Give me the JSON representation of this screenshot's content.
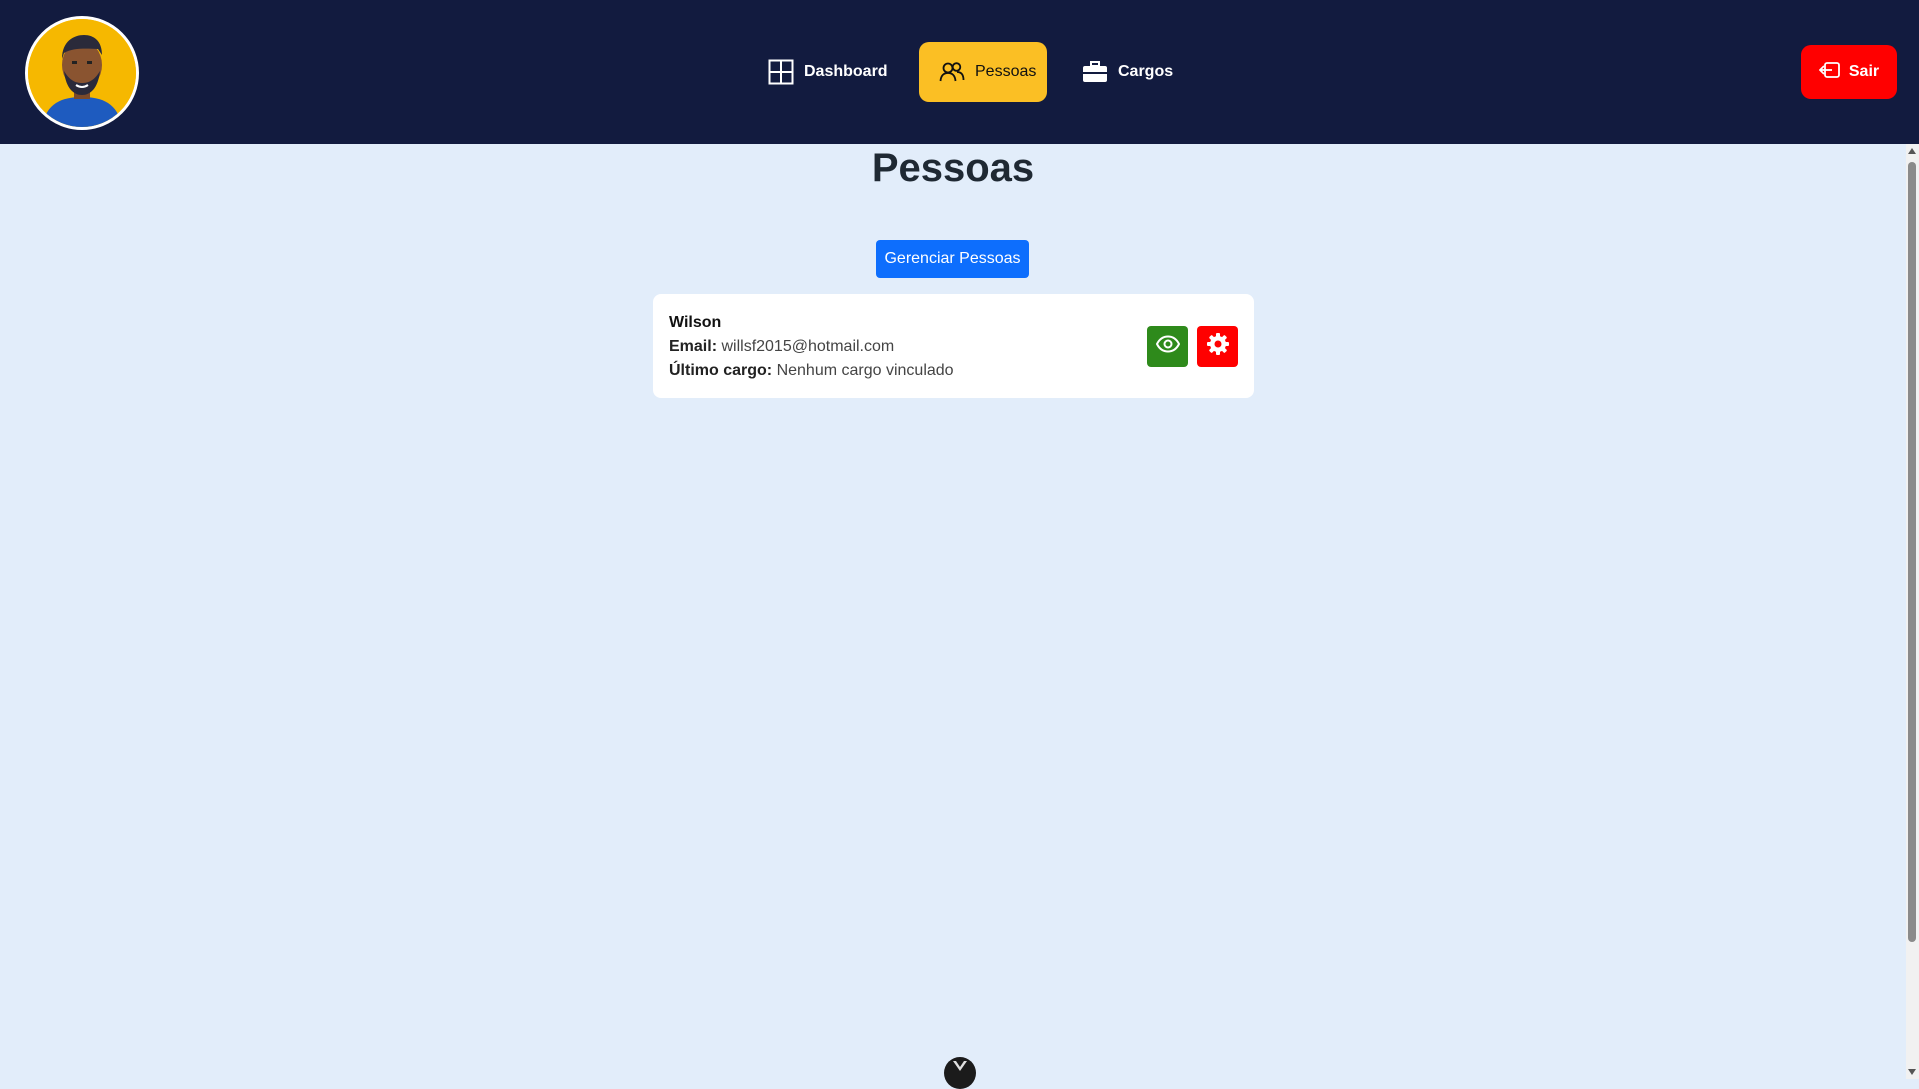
{
  "header": {
    "nav": [
      {
        "label": "Dashboard",
        "icon": "grid-icon",
        "active": false
      },
      {
        "label": "Pessoas",
        "icon": "users-icon",
        "active": true
      },
      {
        "label": "Cargos",
        "icon": "briefcase-icon",
        "active": false
      }
    ],
    "logout_label": "Sair"
  },
  "main": {
    "title": "Pessoas",
    "manage_button": "Gerenciar Pessoas",
    "people": [
      {
        "name": "Wilson",
        "email_label": "Email:",
        "email": "willsf2015@hotmail.com",
        "cargo_label": "Último cargo:",
        "cargo": "Nenhum cargo vinculado"
      }
    ]
  },
  "colors": {
    "header_bg": "#121b3f",
    "active_tab": "#fbbf24",
    "logout": "#ff0000",
    "primary": "#0d6efd",
    "view": "#2e8a1b",
    "edit": "#ff0000",
    "page_bg": "#e2edfa"
  }
}
